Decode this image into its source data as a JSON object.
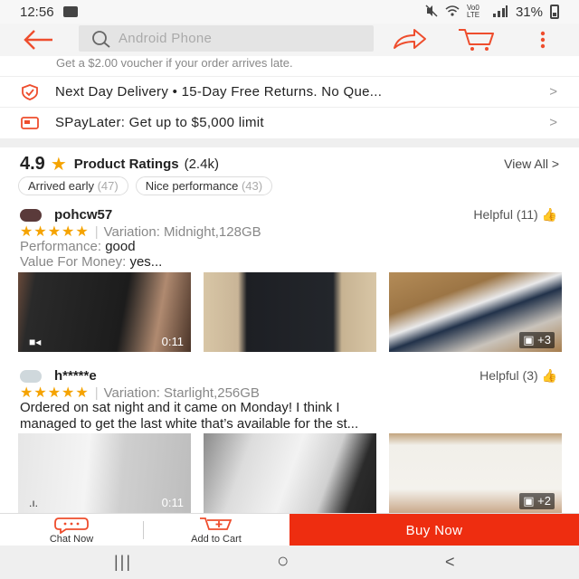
{
  "status_bar": {
    "time": "12:56",
    "network_label": "Vo0 LTE",
    "battery": "31%"
  },
  "header": {
    "search_placeholder": "Android Phone",
    "icons": {
      "back": "back-arrow-icon",
      "search": "search-icon",
      "share": "share-icon",
      "cart": "cart-icon",
      "more": "more-vertical-icon"
    },
    "accent_color": "#ee4d2d"
  },
  "shipping": {
    "voucher_text": "Get a $2.00 voucher if your order arrives late.",
    "delivery_text": "Next Day Delivery  •  15-Day Free Returns. No Que...",
    "paylater_text": "SPayLater: Get up to $5,000 limit",
    "chevron": ">"
  },
  "ratings": {
    "score": "4.9",
    "title": "Product Ratings",
    "count": "(2.4k)",
    "view_all": "View All >",
    "chips": [
      {
        "label": "Arrived early",
        "count": "(47)"
      },
      {
        "label": "Nice performance",
        "count": "(43)"
      }
    ],
    "star_color": "#f5a300"
  },
  "reviews": [
    {
      "username": "pohcw57",
      "helpful": "Helpful (11)",
      "stars": "★★★★★",
      "variation": "Variation: Midnight,128GB",
      "performance_label": "Performance:",
      "performance_value": "good",
      "value_label": "Value For Money:",
      "value_value": "yes...",
      "video_duration": "0:11",
      "more_photos": "+3"
    },
    {
      "username": "h*****e",
      "helpful": "Helpful (3)",
      "stars": "★★★★★",
      "variation": "Variation: Starlight,256GB",
      "text_line1": "Ordered on sat night and it came on Monday! I think I",
      "text_line2": "managed to get the last white that’s available for the st...",
      "video_duration": "0:11",
      "more_photos": "+2"
    }
  ],
  "bottom_bar": {
    "chat_label": "Chat Now",
    "cart_label": "Add to Cart",
    "buy_label": "Buy Now",
    "buy_color": "#ee2d10"
  },
  "nav_bar": {
    "recents": "|||",
    "home": "○",
    "back": "<"
  }
}
